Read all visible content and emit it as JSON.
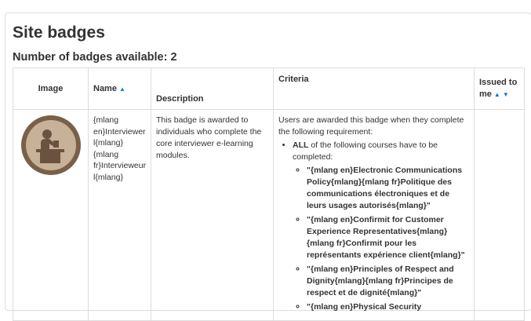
{
  "page": {
    "title": "Site badges",
    "subtitle": "Number of badges available: 2"
  },
  "table": {
    "headers": {
      "image": "Image",
      "name": "Name",
      "description": "Description",
      "criteria": "Criteria",
      "issued_line1": "Issued to",
      "issued_line2": "me"
    },
    "sort_icons": {
      "up": "▲",
      "down": "▼"
    },
    "rows": [
      {
        "badge_icon": "interviewer-badge-icon",
        "name_lines": [
          "{mlang",
          "en}Interviewer",
          "l{mlang}",
          "{mlang",
          "fr}Intervieweur",
          "l{mlang}"
        ],
        "description": "This badge is awarded to individuals who complete the core interviewer e-learning modules.",
        "criteria_intro": "Users are awarded this badge when they complete the following requirement:",
        "criteria_all": "ALL",
        "criteria_all_rest": " of the following courses have to be completed:",
        "courses": [
          "\"{mlang en}Electronic Communications Policy{mlang}{mlang fr}Politique des communications électroniques et de leurs usages autorisés{mlang}\"",
          "\"{mlang en}Confirmit for Customer Experience Representatives{mlang}{mlang fr}Confirmit pour les représentants expérience client{mlang}\"",
          "\"{mlang en}Principles of Respect and Dignity{mlang}{mlang fr}Principes de respect et de dignité{mlang}\"",
          "\"{mlang en}Physical Security"
        ],
        "issued": ""
      }
    ]
  },
  "colors": {
    "badge_outer": "#7a6048",
    "badge_inner": "#c7b299",
    "badge_figure": "#6b5240",
    "link_blue": "#1177d1",
    "border": "#dddddd"
  }
}
